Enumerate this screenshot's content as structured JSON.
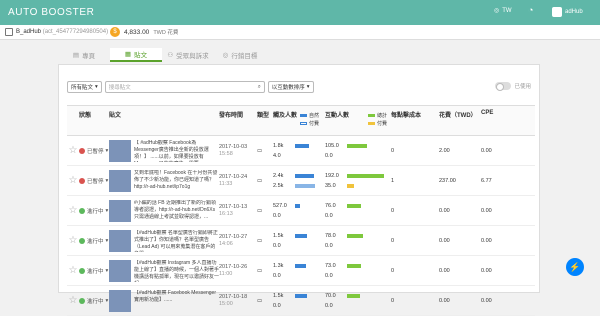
{
  "app": {
    "title": "AUTO BOOSTER",
    "lang": "TW",
    "user": "adHub"
  },
  "account": {
    "name": "B_adHub",
    "id": "(act_454777294980504)"
  },
  "wallet": {
    "amount": "4,833.00",
    "unit": "TWD 花費"
  },
  "tabs": [
    {
      "label": "專頁"
    },
    {
      "label": "貼文"
    },
    {
      "label": "受眾與訴求"
    },
    {
      "label": "行銷目標"
    }
  ],
  "filters": {
    "all_posts": "所有貼文",
    "search_placeholder": "搜尋貼文",
    "sort": "以互動數排序",
    "toggle_label": "已使用"
  },
  "columns": {
    "status": "狀態",
    "post": "貼文",
    "date": "發布時間",
    "type": "類型",
    "reach": "觸及人數",
    "reach_organic": "自然",
    "reach_paid": "付費",
    "engage": "互動人數",
    "engage_total": "總計",
    "engage_paid": "付費",
    "cost_per": "每點擊成本",
    "spend": "花費（TWD）",
    "cpe": "CPE"
  },
  "colors": {
    "reach": "#3a84d6",
    "engage_total": "#7ec83d",
    "engage_paid": "#f0c33c"
  },
  "rows": [
    {
      "status": "已暫停",
      "status_color": "red",
      "text": "【 #adHub觀察 Facebook為Messenger廣告推出全新的投放選項！】 ......以前，如果要投放有Messenger目的的廣告，需要...",
      "date": "2017-10-03",
      "time": "15:58",
      "type": "link",
      "reach_a": "1.8k",
      "reach_b": "4.0",
      "reach_a_frac": 0.12,
      "reach_b_frac": 0.0,
      "eng_a": "105.0",
      "eng_b": "0.0",
      "eng_a_frac": 0.17,
      "eng_b_frac": 0.0,
      "cpc": "0",
      "spend": "2.00",
      "cpe": "0.00"
    },
    {
      "status": "已暫停",
      "status_color": "red",
      "text": "又到年底啦！Facebook 在十月份共發佈了不少新功能，你已經知道了嗎？ http://r-ad-hub.net/ip7o1g",
      "date": "2017-10-24",
      "time": "11:33",
      "type": "link",
      "reach_a": "2.4k",
      "reach_b": "2.5k",
      "reach_a_frac": 0.16,
      "reach_b_frac": 0.17,
      "eng_a": "192.0",
      "eng_b": "35.0",
      "eng_a_frac": 0.31,
      "eng_b_frac": 0.06,
      "cpc": "1",
      "spend": "237.00",
      "cpe": "6.77"
    },
    {
      "status": "進行中",
      "status_color": "green",
      "text": "#小編的話 FB 近期推出了新的行銷領導者認證，http://r-ad-hub.net/Dn6Xs 只需通過線上考試並取得認證，...",
      "date": "2017-10-13",
      "time": "16:13",
      "type": "link",
      "reach_a": "527.0",
      "reach_b": "0.0",
      "reach_a_frac": 0.04,
      "reach_b_frac": 0.0,
      "eng_a": "76.0",
      "eng_b": "0.0",
      "eng_a_frac": 0.12,
      "eng_b_frac": 0.0,
      "cpc": "0",
      "spend": "0.00",
      "cpe": "0.00"
    },
    {
      "status": "進行中",
      "status_color": "green",
      "text": "【#adHub觀察 名單型廣告行銷即將正式推出了】你知道嗎？名單型廣告（Lead Ad) 可以用來蒐集潛在客戶的名單...",
      "date": "2017-10-27",
      "time": "14:06",
      "type": "link",
      "reach_a": "1.5k",
      "reach_b": "0.0",
      "reach_a_frac": 0.1,
      "reach_b_frac": 0.0,
      "eng_a": "78.0",
      "eng_b": "0.0",
      "eng_a_frac": 0.13,
      "eng_b_frac": 0.0,
      "cpc": "0",
      "spend": "0.00",
      "cpe": "0.00"
    },
    {
      "status": "進行中",
      "status_color": "green",
      "text": "【#adHub觀察 Instagram 多人直播功能上線了】直播的時候，一個人對著手機講話有點孤單，現在可以邀請好友一起...",
      "date": "2017-10-26",
      "time": "11:00",
      "type": "link",
      "reach_a": "1.3k",
      "reach_b": "0.0",
      "reach_a_frac": 0.09,
      "reach_b_frac": 0.0,
      "eng_a": "73.0",
      "eng_b": "0.0",
      "eng_a_frac": 0.12,
      "eng_b_frac": 0.0,
      "cpc": "0",
      "spend": "0.00",
      "cpe": "0.00"
    },
    {
      "status": "進行中",
      "status_color": "green",
      "text": "【#adHub觀察 Facebook Messenger 實用新功能】......",
      "date": "2017-10-18",
      "time": "15:00",
      "type": "link",
      "reach_a": "1.5k",
      "reach_b": "0.0",
      "reach_a_frac": 0.1,
      "reach_b_frac": 0.0,
      "eng_a": "70.0",
      "eng_b": "0.0",
      "eng_a_frac": 0.11,
      "eng_b_frac": 0.0,
      "cpc": "0",
      "spend": "0.00",
      "cpe": "0.00"
    }
  ]
}
